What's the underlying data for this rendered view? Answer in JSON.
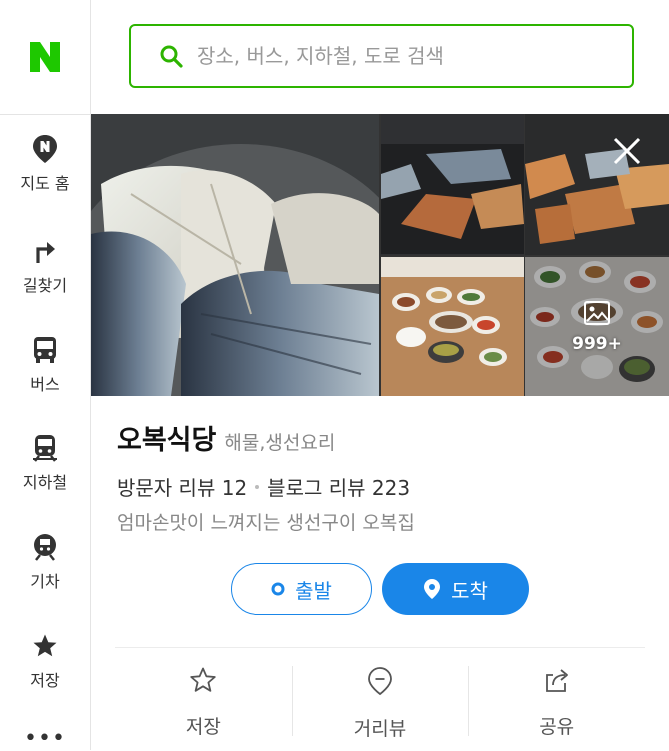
{
  "sidebar": {
    "logo": "N",
    "items": [
      {
        "label": "지도 홈",
        "icon": "map-pin-n-icon"
      },
      {
        "label": "길찾기",
        "icon": "turn-right-arrow-icon"
      },
      {
        "label": "버스",
        "icon": "bus-icon"
      },
      {
        "label": "지하철",
        "icon": "subway-icon"
      },
      {
        "label": "기차",
        "icon": "train-icon"
      },
      {
        "label": "저장",
        "icon": "star-filled-icon"
      }
    ],
    "more": "•••"
  },
  "search": {
    "placeholder": "장소, 버스, 지하철, 도로 검색"
  },
  "photos": {
    "more_count": "999+"
  },
  "place": {
    "name": "오복식당",
    "category": "해물,생선요리",
    "visitor_reviews_label": "방문자 리뷰 12",
    "blog_reviews_label": "블로그 리뷰 223",
    "description": "엄마손맛이 느껴지는 생선구이 오복집"
  },
  "buttons": {
    "start": "출발",
    "arrive": "도착"
  },
  "actions": {
    "save": "저장",
    "streetview": "거리뷰",
    "share": "공유"
  },
  "colors": {
    "naver_green": "#2db400",
    "accent_blue": "#1a86e8"
  }
}
